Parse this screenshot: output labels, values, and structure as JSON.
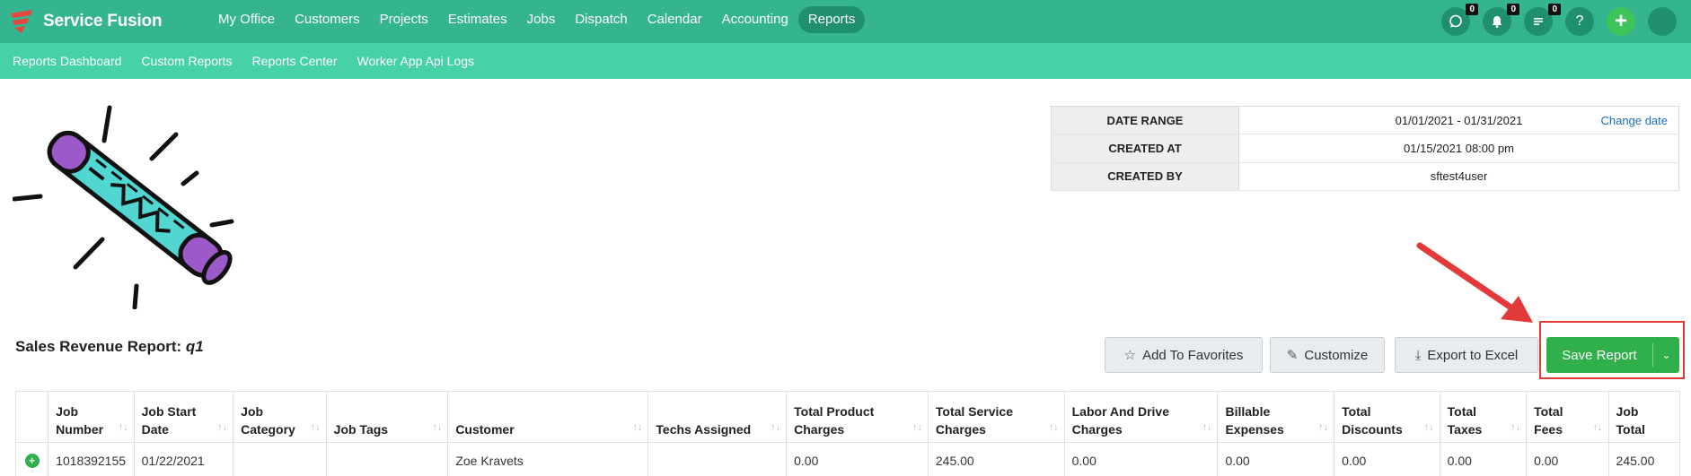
{
  "app": {
    "name": "Service Fusion"
  },
  "nav": {
    "items": [
      "My Office",
      "Customers",
      "Projects",
      "Estimates",
      "Jobs",
      "Dispatch",
      "Calendar",
      "Accounting",
      "Reports"
    ],
    "active": "Reports"
  },
  "header_icons": {
    "chat_badge": "0",
    "notification_badge": "0",
    "tasks_badge": "0",
    "help": "?",
    "add": "+"
  },
  "subnav": {
    "items": [
      "Reports Dashboard",
      "Custom Reports",
      "Reports Center",
      "Worker App Api Logs"
    ]
  },
  "info": {
    "date_range_label": "DATE RANGE",
    "date_range_value": "01/01/2021 - 01/31/2021",
    "change_date": "Change date",
    "created_at_label": "CREATED AT",
    "created_at_value": "01/15/2021 08:00 pm",
    "created_by_label": "CREATED BY",
    "created_by_value": "sftest4user"
  },
  "report": {
    "title_prefix": "Sales Revenue Report:",
    "title_name": "q1"
  },
  "buttons": {
    "favorites": "Add To Favorites",
    "customize": "Customize",
    "export": "Export to Excel",
    "save": "Save Report"
  },
  "table": {
    "columns": [
      {
        "l1": "Job",
        "l2": "Number"
      },
      {
        "l1": "Job Start",
        "l2": "Date"
      },
      {
        "l1": "Job",
        "l2": "Category"
      },
      {
        "l1": "",
        "l2": "Job Tags"
      },
      {
        "l1": "",
        "l2": "Customer"
      },
      {
        "l1": "",
        "l2": "Techs Assigned"
      },
      {
        "l1": "Total Product",
        "l2": "Charges"
      },
      {
        "l1": "Total Service",
        "l2": "Charges"
      },
      {
        "l1": "Labor And Drive",
        "l2": "Charges"
      },
      {
        "l1": "Billable",
        "l2": "Expenses"
      },
      {
        "l1": "Total",
        "l2": "Discounts"
      },
      {
        "l1": "Total",
        "l2": "Taxes"
      },
      {
        "l1": "Total",
        "l2": "Fees"
      },
      {
        "l1": "Job",
        "l2": "Total"
      }
    ],
    "row": [
      "1018392155",
      "01/22/2021",
      "",
      "",
      "Zoe Kravets",
      "",
      "0.00",
      "245.00",
      "0.00",
      "0.00",
      "0.00",
      "0.00",
      "0.00",
      "245.00"
    ]
  },
  "colors": {
    "topbar": "#34b48f",
    "subbar": "#47d1a8",
    "save_button": "#2fb04a",
    "highlight": "#e23a3a"
  },
  "icons": [
    "logo-icon",
    "chat-icon",
    "bell-icon",
    "tasks-icon",
    "help-icon",
    "plus-icon",
    "star-icon",
    "pencil-icon",
    "download-icon",
    "chevron-down-icon",
    "expand-row-icon",
    "sort-icon",
    "party-popper-illustration",
    "red-arrow-annotation"
  ]
}
